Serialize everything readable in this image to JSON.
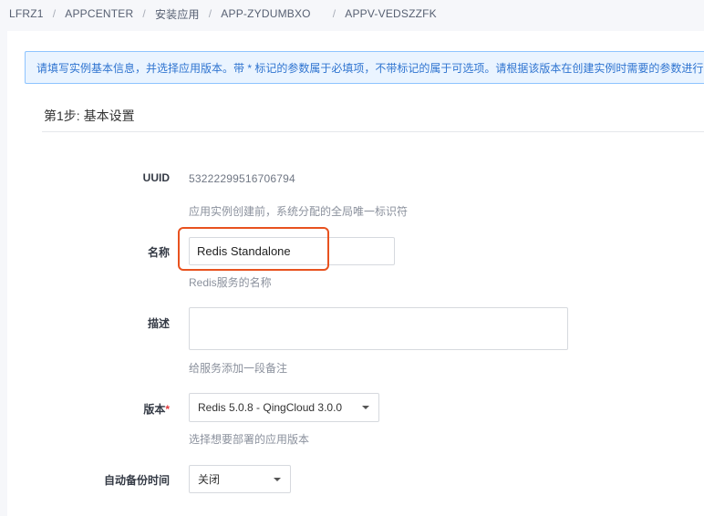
{
  "breadcrumb": {
    "items": [
      "LFRZ1",
      "APPCENTER",
      "安装应用",
      "APP-ZYDUMBXO",
      "APPV-VEDSZZFK"
    ],
    "separator": "/"
  },
  "notice": {
    "text": "请填写实例基本信息，并选择应用版本。带 * 标记的参数属于必填项，不带标记的属于可选项。请根据该版本在创建实例时需要的参数进行"
  },
  "step": {
    "title": "第1步: 基本设置"
  },
  "form": {
    "uuid": {
      "label": "UUID",
      "value": "53222299516706794",
      "help": "应用实例创建前，系统分配的全局唯一标识符"
    },
    "name": {
      "label": "名称",
      "value": "Redis Standalone",
      "help": "Redis服务的名称"
    },
    "description": {
      "label": "描述",
      "value": "",
      "help": "给服务添加一段备注"
    },
    "version": {
      "label": "版本",
      "required_mark": "*",
      "selected": "Redis 5.0.8 - QingCloud 3.0.0",
      "help": "选择想要部署的应用版本"
    },
    "auto_backup": {
      "label": "自动备份时间",
      "selected": "关闭"
    }
  },
  "colors": {
    "highlight": "#e8521f",
    "notice_bg": "#eaf4ff",
    "notice_text": "#2f74d0",
    "required": "#e4393c"
  }
}
